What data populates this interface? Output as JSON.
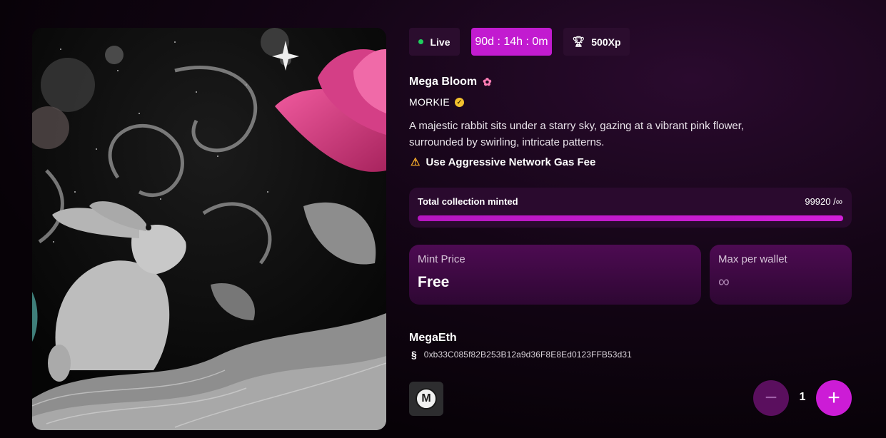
{
  "artwork": {
    "alt_name": "rabbit-and-flower-artwork"
  },
  "status": {
    "live_label": "Live",
    "timer": "90d : 14h : 0m",
    "xp": "500Xp"
  },
  "collection": {
    "title": "Mega Bloom",
    "creator": "MORKIE",
    "description": "A majestic rabbit sits under a starry sky, gazing at a vibrant pink flower, surrounded by swirling, intricate patterns.",
    "warning": "Use Aggressive Network Gas Fee"
  },
  "progress": {
    "label": "Total collection minted",
    "count": "99920 /∞",
    "fraction": 1.0
  },
  "mint": {
    "price_label": "Mint Price",
    "price_value": "Free",
    "max_label": "Max per wallet",
    "max_value": "∞"
  },
  "chain": {
    "name": "MegaEth",
    "address": "0xb33C085f82B253B12a9d36F8E8Ed0123FFB53d31"
  },
  "quantity": {
    "value": "1",
    "minus": "−",
    "plus": "+"
  },
  "colors": {
    "accent": "#c21bd0",
    "live_dot": "#1fd05e",
    "card_bg": "#4d0b52"
  },
  "icons": [
    "trophy-icon",
    "verified-icon",
    "warning-icon",
    "flower-emoji-icon",
    "chain-icon",
    "infinity-icon",
    "megaeth-logo-icon"
  ]
}
